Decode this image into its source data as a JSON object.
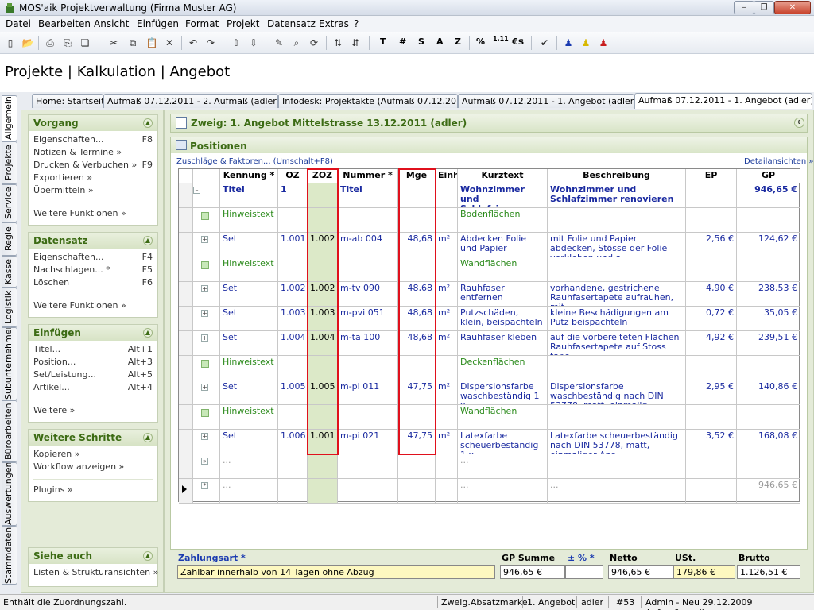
{
  "window": {
    "title": "MOS'aik Projektverwaltung (Firma Muster AG)",
    "min": "–",
    "max": "❐",
    "close": "✕"
  },
  "menu": [
    "Datei",
    "Bearbeiten",
    "Ansicht",
    "Einfügen",
    "Format",
    "Projekt",
    "Datensatz",
    "Extras",
    "?"
  ],
  "toolbar": {
    "t": "T",
    "hash": "#",
    "s": "S",
    "a": "A",
    "z": "Z",
    "pct": "%",
    "num": "1,11",
    "eur": "€$"
  },
  "header": {
    "title": "Projekte | Kalkulation | Angebot"
  },
  "tabs": [
    {
      "label": "Home: Startseite",
      "close": ""
    },
    {
      "label": "Aufmaß 07.12.2011 - 2. Aufmaß (adler)",
      "close": "✕"
    },
    {
      "label": "Infodesk: Projektakte (Aufmaß 07.12.2011)",
      "close": "✕"
    },
    {
      "label": "Aufmaß 07.12.2011 - 1. Angebot (adler)",
      "close": "✕"
    },
    {
      "label": "Aufmaß 07.12.2011 - 1. Angebot (adler)",
      "close": "✕"
    }
  ],
  "vtabs": [
    "Allgemein",
    "Projekte",
    "Service",
    "Regie",
    "Kasse",
    "Logistik",
    "Subunternehmer",
    "Büroarbeiten",
    "Auswertungen",
    "Stammdaten"
  ],
  "sidebar": {
    "vorgang": {
      "title": "Vorgang",
      "items": [
        {
          "label": "Eigenschaften...",
          "key": "F8"
        },
        {
          "label": "Notizen & Termine »",
          "key": ""
        },
        {
          "label": "Drucken & Verbuchen »",
          "key": "F9"
        },
        {
          "label": "Exportieren »",
          "key": ""
        },
        {
          "label": "Übermitteln »",
          "key": ""
        }
      ],
      "more": "Weitere Funktionen »"
    },
    "datensatz": {
      "title": "Datensatz",
      "items": [
        {
          "label": "Eigenschaften...",
          "key": "F4"
        },
        {
          "label": "Nachschlagen... *",
          "key": "F5"
        },
        {
          "label": "Löschen",
          "key": "F6"
        }
      ],
      "more": "Weitere Funktionen »"
    },
    "einfuegen": {
      "title": "Einfügen",
      "items": [
        {
          "label": "Titel...",
          "key": "Alt+1"
        },
        {
          "label": "Position...",
          "key": "Alt+3"
        },
        {
          "label": "Set/Leistung...",
          "key": "Alt+5"
        },
        {
          "label": "Artikel...",
          "key": "Alt+4"
        }
      ],
      "more": "Weitere »"
    },
    "schritte": {
      "title": "Weitere Schritte",
      "items": [
        {
          "label": "Kopieren »",
          "key": ""
        },
        {
          "label": "Workflow anzeigen »",
          "key": ""
        }
      ],
      "more": "Plugins »"
    },
    "siehe": {
      "title": "Siehe auch",
      "items": [
        {
          "label": "Listen & Strukturansichten »",
          "key": ""
        }
      ]
    }
  },
  "branch": {
    "title": "Zweig: 1. Angebot Mittelstrasse 13.12.2011 (adler)"
  },
  "positions": {
    "title": "Positionen",
    "surcharges": "Zuschläge & Faktoren... (Umschalt+F8)",
    "details": "Detailansichten »"
  },
  "table": {
    "headers": [
      "Kennung *",
      "OZ",
      "ZOZ",
      "Nummer *",
      "Mge",
      "Einh",
      "Kurztext",
      "Beschreibung",
      "EP",
      "GP"
    ],
    "rows": [
      {
        "type": "title",
        "tree": "–",
        "kennung": "Titel",
        "oz": "1",
        "zoz": "",
        "nummer": "Titel",
        "mge": "",
        "einh": "",
        "kurz": "Wohnzimmer und Schlafzimmer ren...",
        "besch": "Wohnzimmer und Schlafzimmer renovieren",
        "ep": "",
        "gp": "946,65 €"
      },
      {
        "type": "hint",
        "tree": "",
        "kennung": "Hinweistext",
        "oz": "",
        "zoz": "",
        "nummer": "",
        "mge": "",
        "einh": "",
        "kurz": "Bodenflächen",
        "besch": "",
        "ep": "",
        "gp": ""
      },
      {
        "type": "set",
        "tree": "+",
        "kennung": "Set",
        "oz": "1.001",
        "zoz": "1.002",
        "nummer": "m-ab 004",
        "mge": "48,68",
        "einh": "m²",
        "kurz": "Abdecken Folie und Papier",
        "besch": "mit Folie und Papier abdecken, Stösse der Folie verkleben und a...",
        "ep": "2,56 €",
        "gp": "124,62 €"
      },
      {
        "type": "hint",
        "tree": "",
        "kennung": "Hinweistext",
        "oz": "",
        "zoz": "",
        "nummer": "",
        "mge": "",
        "einh": "",
        "kurz": "Wandflächen",
        "besch": "",
        "ep": "",
        "gp": ""
      },
      {
        "type": "set",
        "tree": "+",
        "kennung": "Set",
        "oz": "1.002",
        "zoz": "1.002",
        "nummer": "m-tv 090",
        "mge": "48,68",
        "einh": "m²",
        "kurz": "Rauhfaser entfernen",
        "besch": "vorhandene, gestrichene Rauhfasertapete aufrauhen, mit...",
        "ep": "4,90 €",
        "gp": "238,53 €"
      },
      {
        "type": "set",
        "tree": "+",
        "kennung": "Set",
        "oz": "1.003",
        "zoz": "1.003",
        "nummer": "m-pvi 051",
        "mge": "48,68",
        "einh": "m²",
        "kurz": "Putzschäden, klein, beispachteln",
        "besch": "kleine Beschädigungen am Putz beispachteln",
        "ep": "0,72 €",
        "gp": "35,05 €"
      },
      {
        "type": "set",
        "tree": "+",
        "kennung": "Set",
        "oz": "1.004",
        "zoz": "1.004",
        "nummer": "m-ta 100",
        "mge": "48,68",
        "einh": "m²",
        "kurz": "Rauhfaser kleben",
        "besch": "auf die vorbereiteten Flächen Rauhfasertapete auf Stoss tape...",
        "ep": "4,92 €",
        "gp": "239,51 €"
      },
      {
        "type": "hint",
        "tree": "",
        "kennung": "Hinweistext",
        "oz": "",
        "zoz": "",
        "nummer": "",
        "mge": "",
        "einh": "",
        "kurz": "Deckenflächen",
        "besch": "",
        "ep": "",
        "gp": ""
      },
      {
        "type": "set",
        "tree": "+",
        "kennung": "Set",
        "oz": "1.005",
        "zoz": "1.005",
        "nummer": "m-pi 011",
        "mge": "47,75",
        "einh": "m²",
        "kurz": "Dispersionsfarbe waschbeständig 1 x",
        "besch": "Dispersionsfarbe waschbeständig nach DIN 53778, matt, einmalig...",
        "ep": "2,95 €",
        "gp": "140,86 €"
      },
      {
        "type": "hint",
        "tree": "",
        "kennung": "Hinweistext",
        "oz": "",
        "zoz": "",
        "nummer": "",
        "mge": "",
        "einh": "",
        "kurz": "Wandflächen",
        "besch": "",
        "ep": "",
        "gp": ""
      },
      {
        "type": "set",
        "tree": "+",
        "kennung": "Set",
        "oz": "1.006",
        "zoz": "1.001",
        "nummer": "m-pi 021",
        "mge": "47,75",
        "einh": "m²",
        "kurz": "Latexfarbe scheuerbeständig 1 x",
        "besch": "Latexfarbe scheuerbeständig nach DIN 53778, matt, einmaliger Ans...",
        "ep": "3,52 €",
        "gp": "168,08 €"
      },
      {
        "type": "empty",
        "tree": "»",
        "kennung": "...",
        "oz": "",
        "zoz": "",
        "nummer": "",
        "mge": "",
        "einh": "",
        "kurz": "...",
        "besch": "",
        "ep": "",
        "gp": ""
      },
      {
        "type": "new",
        "tree": "*",
        "kennung": "...",
        "oz": "",
        "zoz": "",
        "nummer": "",
        "mge": "",
        "einh": "",
        "kurz": "...",
        "besch": "...",
        "ep": "",
        "gp": "946,65 €"
      }
    ]
  },
  "footer": {
    "zahlungsart_label": "Zahlungsart *",
    "zahlungsart_value": "Zahlbar innerhalb von 14 Tagen ohne Abzug",
    "gp_summe_label": "GP Summe",
    "gp_summe_value": "946,65 €",
    "pct_label": "± % *",
    "pct_value": "",
    "netto_label": "Netto",
    "netto_value": "946,65 €",
    "ust_label": "USt.",
    "ust_value": "179,86 €",
    "brutto_label": "Brutto",
    "brutto_value": "1.126,51 €"
  },
  "status": {
    "hint": "Enthält die Zuordnungszahl.",
    "mark": "Zweig.Absatzmarke",
    "offer": "1. Angebot",
    "user": "adler",
    "num": "#53",
    "db": "Admin - Neu 29.12.2009 Aufmaße.mdb"
  }
}
